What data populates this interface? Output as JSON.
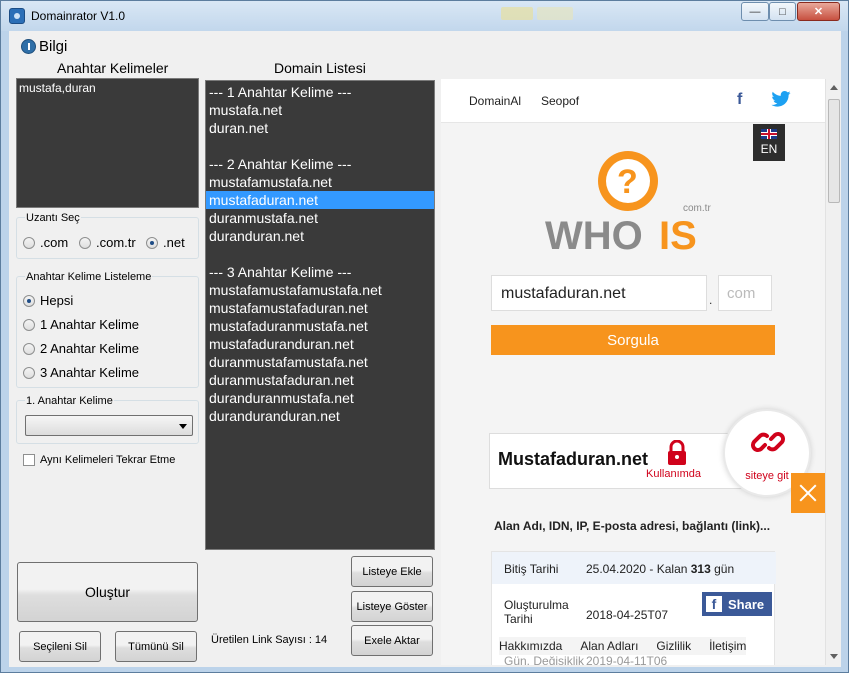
{
  "window": {
    "title": "Domainrator V1.0",
    "controls": {
      "minimize": "—",
      "maximize": "□",
      "close": "✕"
    }
  },
  "menu": {
    "info_label": "Bilgi"
  },
  "keywords": {
    "title": "Anahtar Kelimeler",
    "value": "mustafa,duran"
  },
  "extension": {
    "group_label": "Uzantı Seç",
    "options": [
      ".com",
      ".com.tr",
      ".net"
    ],
    "selected": ".net"
  },
  "listing": {
    "group_label": "Anahtar Kelime Listeleme",
    "options": [
      "Hepsi",
      "1 Anahtar Kelime",
      "2 Anahtar Kelime",
      "3 Anahtar Kelime"
    ],
    "selected": "Hepsi"
  },
  "first_keyword": {
    "group_label": "1. Anahtar Kelime",
    "value": ""
  },
  "no_repeat": {
    "label": "Aynı Kelimeleri Tekrar Etme",
    "checked": false
  },
  "buttons": {
    "create": "Oluştur",
    "delete_selected": "Seçileni Sil",
    "delete_all": "Tümünü Sil",
    "add_to_list": "Listeye Ekle",
    "show_list": "Listeye Göster",
    "export_excel": "Exele Aktar"
  },
  "domain_list": {
    "title": "Domain Listesi",
    "lines": [
      "--- 1 Anahtar Kelime ---",
      "mustafa.net",
      "duran.net",
      "",
      "--- 2 Anahtar Kelime ---",
      "mustafamustafa.net",
      "mustafaduran.net",
      "duranmustafa.net",
      "duranduran.net",
      "",
      "--- 3 Anahtar Kelime ---",
      "mustafamustafamustafa.net",
      "mustafamustafaduran.net",
      "mustafaduranmustafa.net",
      "mustafaduranduran.net",
      "duranmustafamustafa.net",
      "duranmustafaduran.net",
      "duranduranmustafa.net",
      "duranduranduran.net"
    ],
    "selected_index": 6
  },
  "link_count": {
    "label": "Üretilen Link Sayısı : 14"
  },
  "browser": {
    "nav": [
      "DomainAl",
      "Seopof"
    ],
    "lang": "EN",
    "logo_text": "WHOIS",
    "logo_suffix": "com.tr",
    "domain_input": "mustafaduran.net",
    "tld_dot": ".",
    "tld_placeholder": "com",
    "query_button": "Sorgula",
    "result_domain": "Mustafaduran.net",
    "result_status": "Kullanımda",
    "visit_label": "siteye git",
    "description": "Alan Adı, IDN, IP, E-posta adresi, bağlantı (link)...",
    "info_rows": [
      {
        "key": "Bitiş Tarihi",
        "value_prefix": "25.04.2020 - Kalan ",
        "value_bold": "313",
        "value_suffix": " gün"
      },
      {
        "key": "Oluşturulma Tarihi",
        "value": "2018-04-25T07"
      },
      {
        "key": "Gün. Değişiklik",
        "value": "2019-04-11T06"
      }
    ],
    "share_label": "Share",
    "footer_links": [
      "Hakkımızda",
      "Alan Adları",
      "Gizlilik",
      "İletişim"
    ],
    "colors": {
      "orange": "#f7941d",
      "red": "#d0021b",
      "facebook": "#3b5998",
      "twitter": "#1da1f2"
    }
  },
  "icons": [
    "app-icon",
    "info-icon",
    "facebook-icon",
    "twitter-icon",
    "uk-flag-icon",
    "whois-logo",
    "lock-icon",
    "chain-link-icon",
    "close-icon",
    "facebook-share-icon"
  ]
}
